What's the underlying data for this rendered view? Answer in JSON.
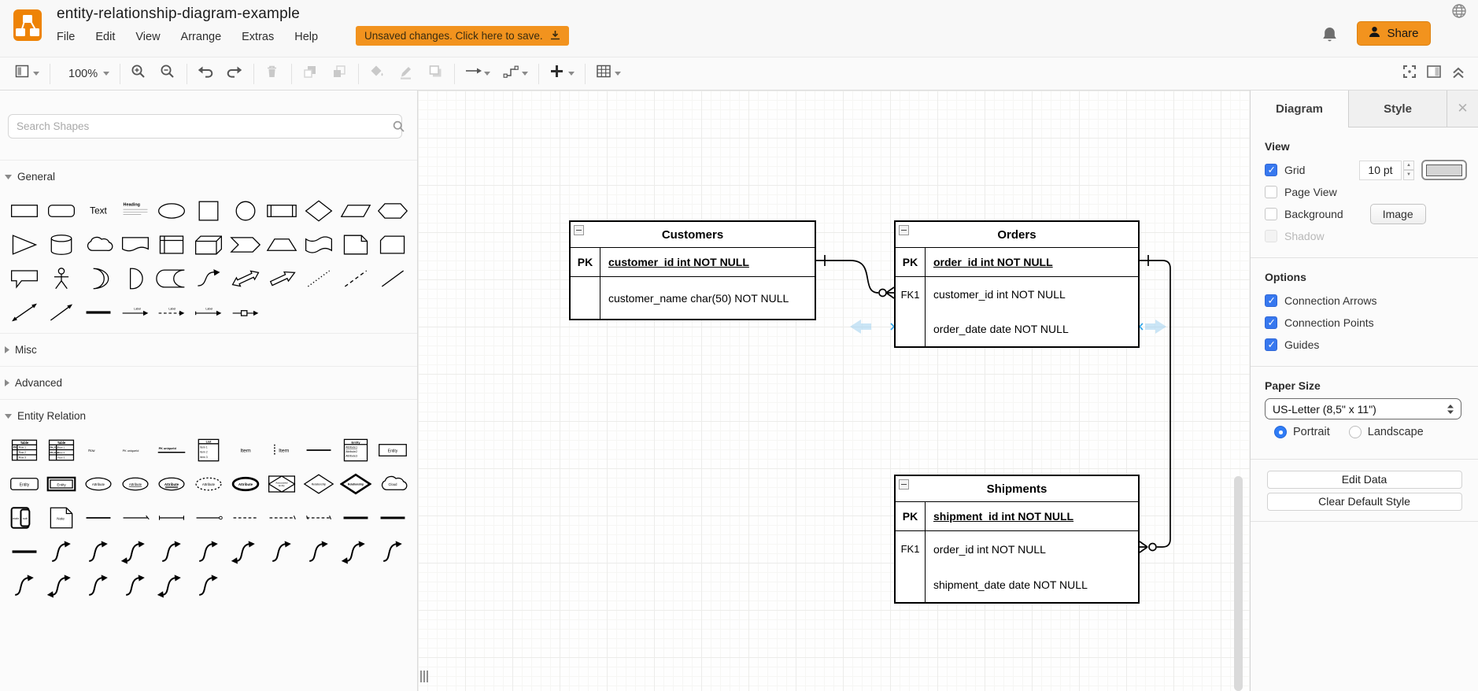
{
  "app": {
    "title": "entity-relationship-diagram-example",
    "accent_color": "#F2931E",
    "logo_color": "#EE8306"
  },
  "header": {
    "menus": [
      "File",
      "Edit",
      "View",
      "Arrange",
      "Extras",
      "Help"
    ],
    "banner": {
      "label": "Unsaved changes. Click here to save.",
      "icon": "download-icon"
    },
    "share": {
      "label": "Share",
      "icon": "person-icon"
    },
    "notification_icon": "bell-icon",
    "language_icon": "globe-icon"
  },
  "toolbar": {
    "zoom_level": "100%",
    "items": [
      {
        "icon": "format-panel-icon",
        "dropdown": true,
        "enabled": true
      },
      {
        "sep": true
      },
      {
        "zoom": true,
        "dropdown": true,
        "enabled": true
      },
      {
        "sep": true
      },
      {
        "icon": "zoom-in-icon",
        "enabled": true
      },
      {
        "icon": "zoom-out-icon",
        "enabled": true
      },
      {
        "sep": true
      },
      {
        "icon": "undo-icon",
        "enabled": true
      },
      {
        "icon": "redo-icon",
        "enabled": true
      },
      {
        "sep": true
      },
      {
        "icon": "delete-icon",
        "enabled": false
      },
      {
        "sep": true
      },
      {
        "icon": "to-front-icon",
        "enabled": false
      },
      {
        "icon": "to-back-icon",
        "enabled": false
      },
      {
        "sep": true
      },
      {
        "icon": "fill-color-icon",
        "enabled": false
      },
      {
        "icon": "line-color-icon",
        "enabled": false
      },
      {
        "icon": "shadow-icon",
        "enabled": false
      },
      {
        "sep": true
      },
      {
        "icon": "connection-icon",
        "dropdown": true,
        "enabled": true
      },
      {
        "icon": "waypoints-icon",
        "dropdown": true,
        "enabled": true
      },
      {
        "sep": true
      },
      {
        "icon": "insert-icon",
        "dropdown": true,
        "enabled": true
      },
      {
        "sep": true
      },
      {
        "icon": "table-icon",
        "dropdown": true,
        "enabled": true
      }
    ],
    "right_icons": [
      "fullscreen-icon",
      "format-toggle-icon",
      "collapse-icon"
    ]
  },
  "sidebar": {
    "search": {
      "placeholder": "Search Shapes",
      "icon": "search-icon"
    },
    "sections": [
      {
        "label": "General",
        "expanded": true
      },
      {
        "label": "Misc",
        "expanded": false
      },
      {
        "label": "Advanced",
        "expanded": false
      },
      {
        "label": "Entity Relation",
        "expanded": true
      }
    ],
    "general_shapes": [
      "rectangle",
      "rounded-rectangle",
      "text",
      "textbox",
      "ellipse",
      "square",
      "circle",
      "process",
      "diamond",
      "parallelogram",
      "hexagon",
      "triangle",
      "cylinder",
      "cloud",
      "document",
      "internal-storage",
      "cube",
      "step",
      "trapezoid",
      "tape",
      "note",
      "card",
      "callout",
      "actor",
      "or",
      "and",
      "data-storage",
      "curve",
      "bidirectional-arrow",
      "arrow",
      "dotted-line",
      "dashed-line",
      "line",
      "bidirectional-connector",
      "directional-connector",
      "link",
      "labeled-arrow-1",
      "labeled-arrow-2",
      "labeled-arrow-3",
      "labeled-arrow-4"
    ],
    "entity_relation_shapes": [
      "table",
      "table-2",
      "row",
      "row-pk",
      "row-pk-line",
      "list",
      "item",
      "item-dotted",
      "separator-line",
      "entity-with-attributes",
      "entity",
      "entity-rounded",
      "entity-double",
      "attribute",
      "attribute-underline",
      "attribute-double-underline",
      "attribute-dashed",
      "attribute-bold",
      "associative-entity",
      "relationship",
      "relationship-bold",
      "cloud-er",
      "composite-entity",
      "note-er",
      "line-solid",
      "line-end-1",
      "line-end-2",
      "line-end-3",
      "line-dashed-1",
      "line-dashed-2",
      "line-dashed-3",
      "line-bold-1",
      "line-bold-2",
      "link-bold",
      "er-edge-1",
      "er-edge-2",
      "er-edge-3",
      "er-edge-4",
      "er-edge-5",
      "er-edge-6",
      "er-edge-7",
      "er-edge-8",
      "er-edge-9",
      "er-edge-10",
      "er-edge-11",
      "er-edge-12",
      "er-edge-13",
      "er-edge-14",
      "er-edge-15",
      "er-edge-16"
    ],
    "shape_labels": {
      "text": "Text",
      "heading": "Heading",
      "item": "Item",
      "entity": "Entity",
      "attribute": "Attribute",
      "relationship": "Relationship",
      "cloud": "Cloud",
      "note": "Note",
      "list": "List",
      "table": "Table",
      "row": "Row",
      "row_pk": "PK uniqueId",
      "main": "main",
      "sub": "sub",
      "label": "Label"
    }
  },
  "canvas": {
    "tables": [
      {
        "title": "Customers",
        "rows": [
          {
            "key": "PK",
            "text": "customer_id int NOT NULL",
            "pk": true
          },
          {
            "key": "",
            "text": "customer_name char(50) NOT NULL",
            "pk": false
          }
        ]
      },
      {
        "title": "Orders",
        "rows": [
          {
            "key": "PK",
            "text": "order_id int NOT NULL",
            "pk": true
          },
          {
            "key": "FK1",
            "text": "customer_id int NOT NULL",
            "pk": false
          },
          {
            "key": "",
            "text": "order_date date NOT NULL",
            "pk": false
          }
        ]
      },
      {
        "title": "Shipments",
        "rows": [
          {
            "key": "PK",
            "text": "shipment_id int NOT NULL",
            "pk": true
          },
          {
            "key": "FK1",
            "text": "order_id int NOT NULL",
            "pk": false
          },
          {
            "key": "",
            "text": "shipment_date date NOT NULL",
            "pk": false
          }
        ]
      }
    ],
    "relationships": [
      {
        "from": "Customers.customer_id",
        "to": "Orders.customer_id",
        "notation": "one-to-zero-or-many"
      },
      {
        "from": "Orders.order_id",
        "to": "Shipments.order_id",
        "notation": "one-to-zero-or-many"
      }
    ]
  },
  "panel": {
    "tabs": [
      {
        "label": "Diagram",
        "active": true
      },
      {
        "label": "Style",
        "active": false
      }
    ],
    "close_icon": "close-icon",
    "view": {
      "label": "View",
      "checkboxes": [
        {
          "label": "Grid",
          "checked": true
        },
        {
          "label": "Page View",
          "checked": false
        },
        {
          "label": "Background",
          "checked": false
        },
        {
          "label": "Shadow",
          "checked": false,
          "disabled": true
        }
      ],
      "grid_size": "10 pt",
      "image_button": "Image"
    },
    "options": {
      "label": "Options",
      "checkboxes": [
        {
          "label": "Connection Arrows",
          "checked": true
        },
        {
          "label": "Connection Points",
          "checked": true
        },
        {
          "label": "Guides",
          "checked": true
        }
      ]
    },
    "paper": {
      "label": "Paper Size",
      "value": "US-Letter (8,5\" x 11\")",
      "orientation": [
        {
          "label": "Portrait",
          "selected": true
        },
        {
          "label": "Landscape",
          "selected": false
        }
      ]
    },
    "buttons": [
      "Edit Data",
      "Clear Default Style"
    ]
  }
}
